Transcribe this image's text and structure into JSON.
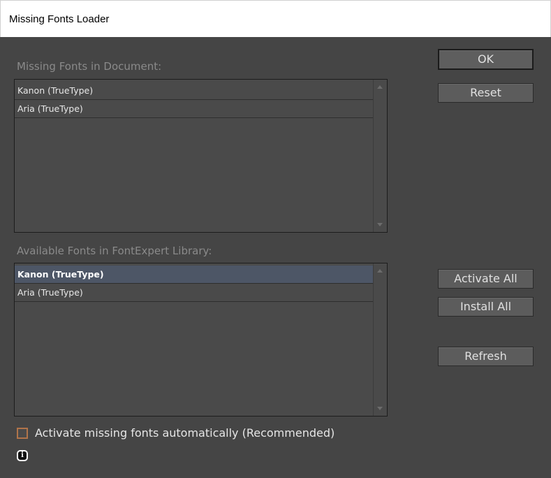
{
  "window": {
    "title": "Missing Fonts Loader"
  },
  "missing": {
    "label": "Missing Fonts in Document:",
    "items": [
      {
        "label": "Kanon (TrueType)"
      },
      {
        "label": "Aria (TrueType)"
      }
    ]
  },
  "available": {
    "label": "Available Fonts in FontExpert Library:",
    "items": [
      {
        "label": "Kanon (TrueType)",
        "selected": true
      },
      {
        "label": "Aria (TrueType)",
        "selected": false
      }
    ]
  },
  "buttons": {
    "ok": "OK",
    "reset": "Reset",
    "activate_all": "Activate All",
    "install_all": "Install All",
    "refresh": "Refresh"
  },
  "auto_activate": {
    "label": "Activate missing fonts automatically (Recommended)",
    "checked": false
  },
  "info_icon": {
    "glyph": "i"
  },
  "colors": {
    "dialog_bg": "#454545",
    "checkbox_border": "#b0744a",
    "selection": "#4d5666"
  }
}
